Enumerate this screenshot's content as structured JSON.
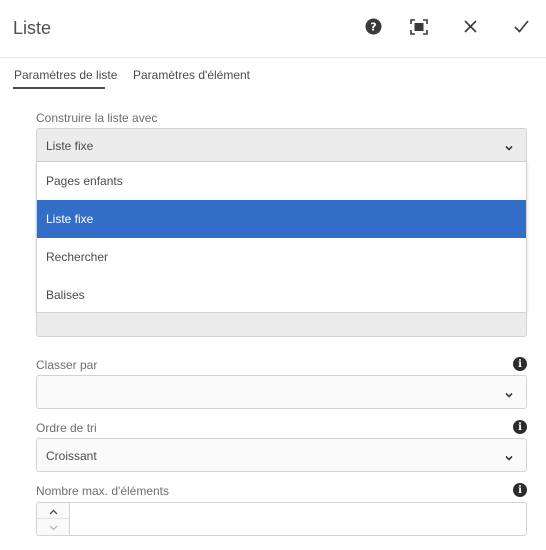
{
  "header": {
    "title": "Liste",
    "buttons": [
      {
        "name": "help",
        "icon": "help-icon"
      },
      {
        "name": "fullscreen",
        "icon": "fullscreen-icon"
      },
      {
        "name": "cancel",
        "icon": "close-icon"
      },
      {
        "name": "done",
        "icon": "checkmark-icon"
      }
    ]
  },
  "tabs": [
    {
      "label": "Paramètres de liste",
      "active": true
    },
    {
      "label": "Paramètres d'élément",
      "active": false
    }
  ],
  "form": {
    "build_list": {
      "label": "Construire la liste avec",
      "value": "Liste fixe",
      "options": [
        {
          "label": "Pages enfants",
          "selected": false
        },
        {
          "label": "Liste fixe",
          "selected": true
        },
        {
          "label": "Rechercher",
          "selected": false
        },
        {
          "label": "Balises",
          "selected": false
        }
      ]
    },
    "order_by": {
      "label": "Classer par",
      "value": ""
    },
    "sort_order": {
      "label": "Ordre de tri",
      "value": "Croissant"
    },
    "max_items": {
      "label": "Nombre max. d'éléments",
      "value": ""
    }
  },
  "colors": {
    "accent": "#326ec8",
    "text": "#4b4b4b",
    "border": "#d3d3d3"
  }
}
